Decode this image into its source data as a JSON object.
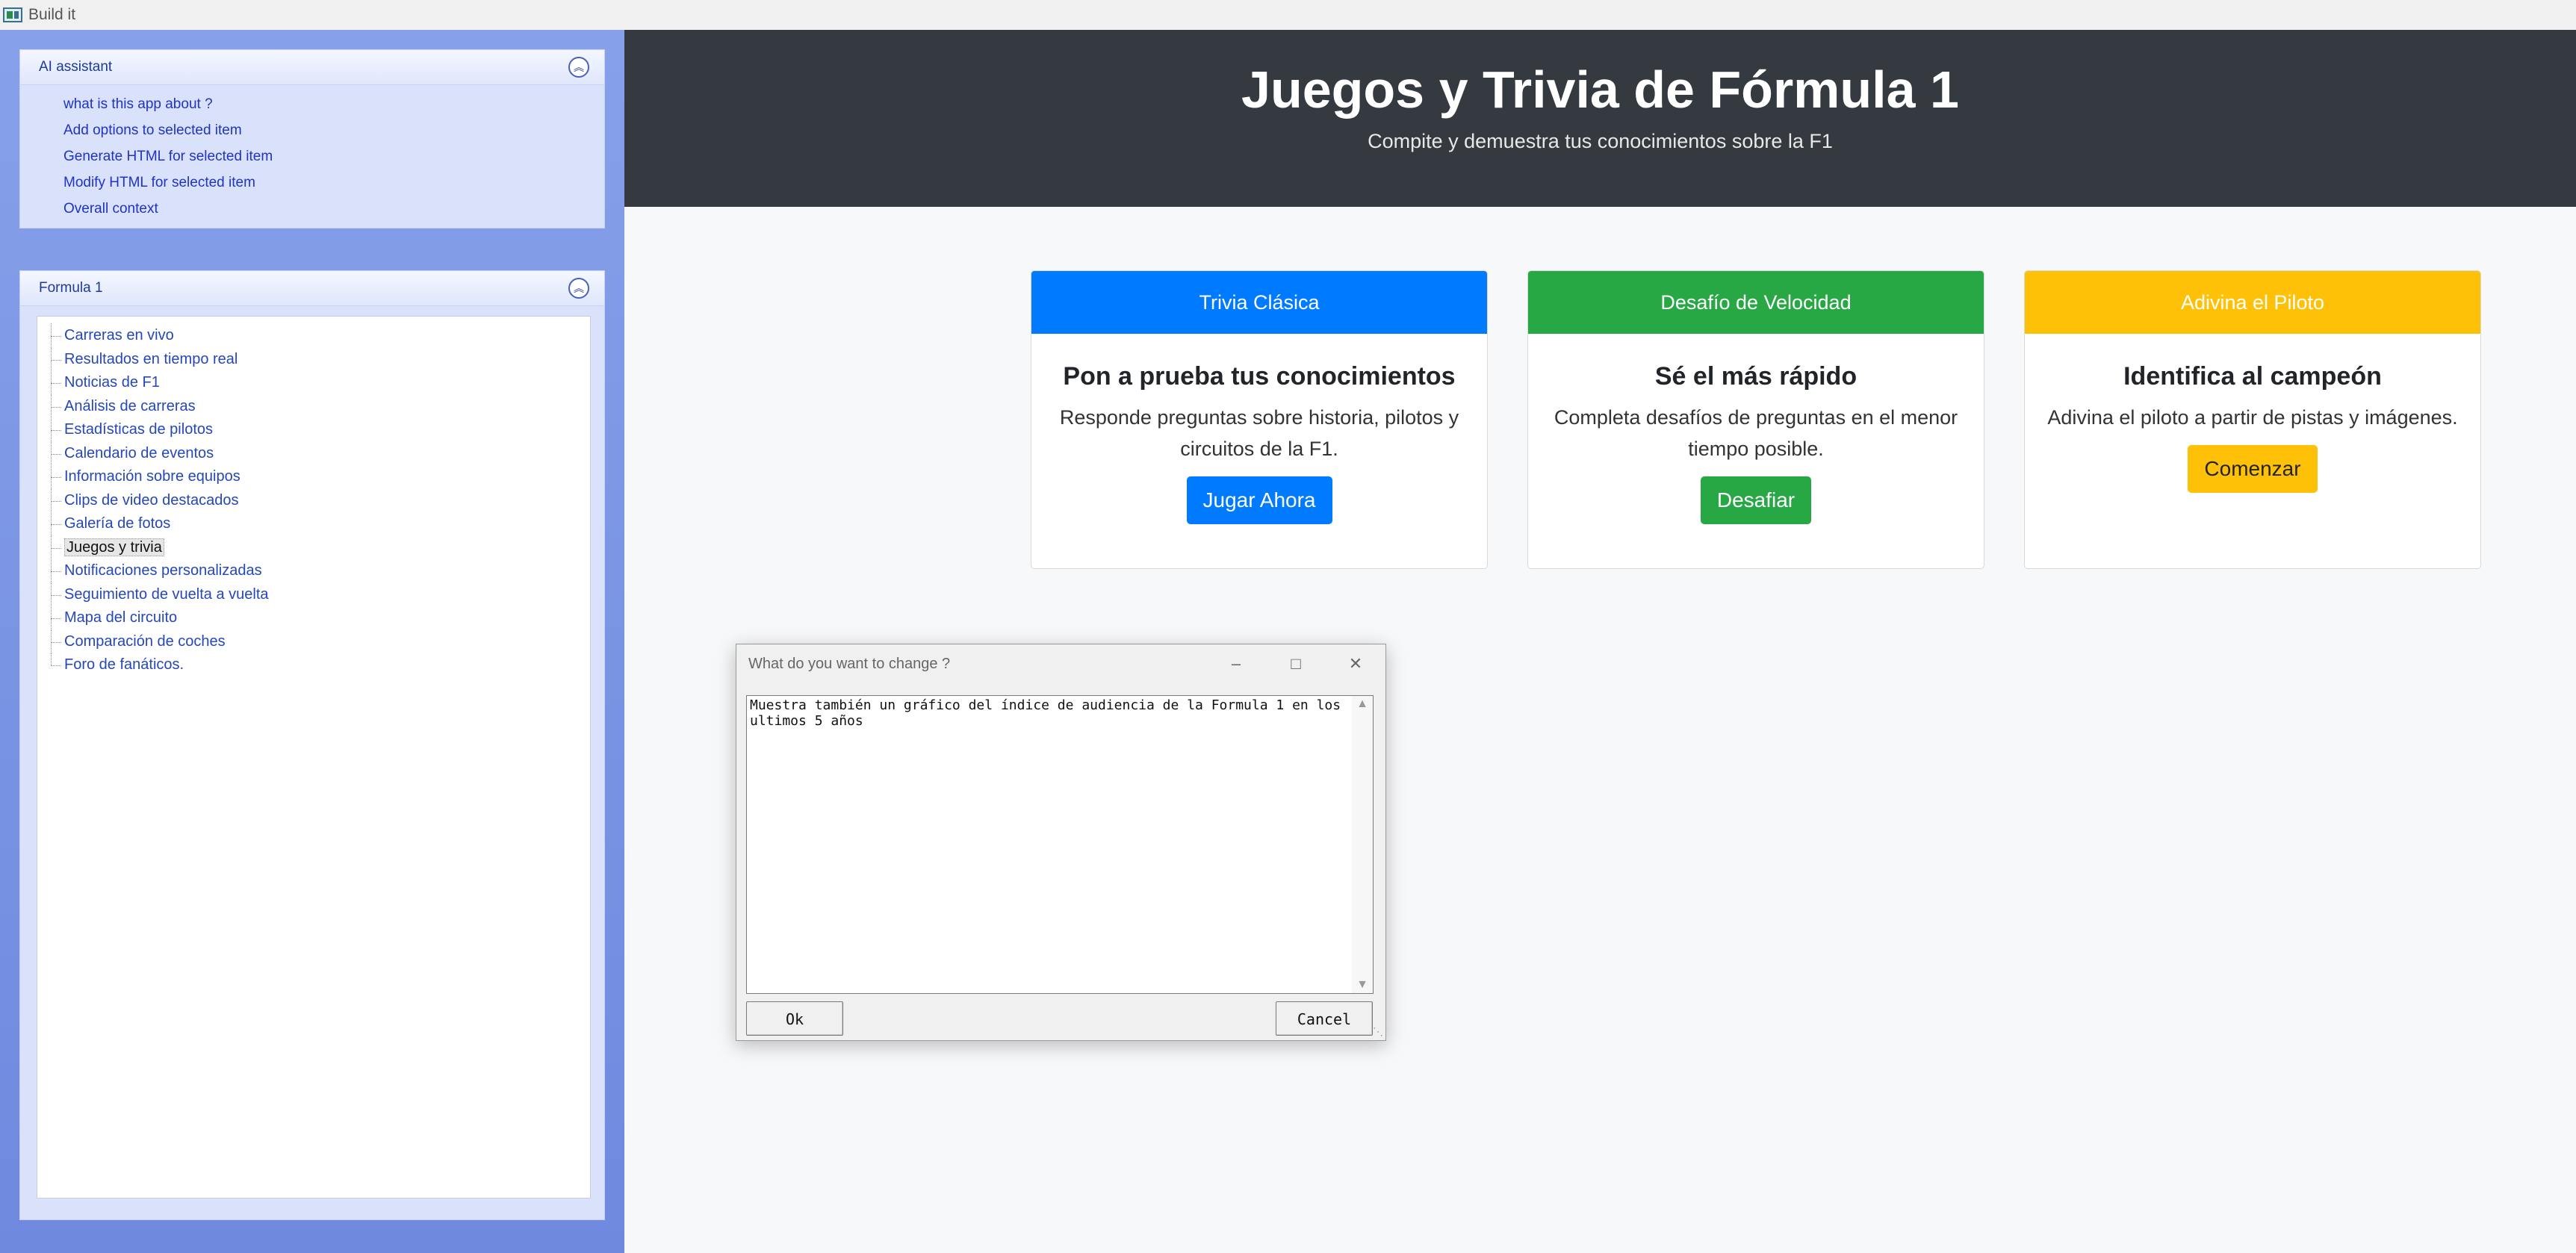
{
  "window": {
    "title": "Build it"
  },
  "ai_assistant": {
    "title": "AI assistant",
    "items": [
      "what is this app about ?",
      "Add options to selected item",
      "Generate HTML for selected item",
      "Modify HTML for selected item",
      "Overall context"
    ]
  },
  "formula": {
    "title": "Formula 1",
    "items": [
      "Carreras en vivo",
      "Resultados en tiempo real",
      "Noticias de F1",
      "Análisis de carreras",
      "Estadísticas de pilotos",
      "Calendario de eventos",
      "Información sobre equipos",
      "Clips de video destacados",
      "Galería de fotos",
      "Juegos y trivia",
      "Notificaciones personalizadas",
      "Seguimiento de vuelta a vuelta",
      "Mapa del circuito",
      "Comparación de coches",
      "Foro de fanáticos."
    ],
    "selected_index": 9
  },
  "hero": {
    "title": "Juegos y Trivia de Fórmula 1",
    "subtitle": "Compite y demuestra tus conocimientos sobre la F1"
  },
  "cards": [
    {
      "header": "Trivia Clásica",
      "title": "Pon a prueba tus conocimientos",
      "text": "Responde preguntas sobre historia, pilotos y circuitos de la F1.",
      "button": "Jugar Ahora",
      "color": "#007bff",
      "button_text_color": "#ffffff"
    },
    {
      "header": "Desafío de Velocidad",
      "title": "Sé el más rápido",
      "text": "Completa desafíos de preguntas en el menor tiempo posible.",
      "button": "Desafiar",
      "color": "#28a745",
      "button_text_color": "#ffffff"
    },
    {
      "header": "Adivina el Piloto",
      "title": "Identifica al campeón",
      "text": "Adivina el piloto a partir de pistas y imágenes.",
      "button": "Comenzar",
      "color": "#ffc107",
      "button_text_color": "#212529"
    }
  ],
  "dialog": {
    "title": "What do you want to change ?",
    "text": "Muestra también un gráfico del índice de audiencia de la Formula 1 en los ultimos 5 años",
    "ok": "Ok",
    "cancel": "Cancel"
  }
}
